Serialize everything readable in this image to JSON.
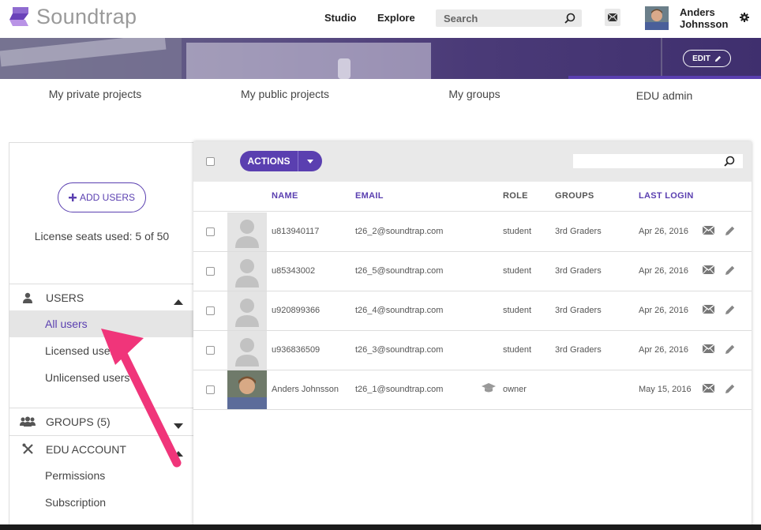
{
  "header": {
    "logo_text": "Soundtrap",
    "nav": [
      "Studio",
      "Explore"
    ],
    "search_placeholder": "Search",
    "user_first": "Anders",
    "user_last": "Johnsson"
  },
  "banner": {
    "edit_label": "EDIT"
  },
  "tabs": [
    {
      "label": "My private projects"
    },
    {
      "label": "My public projects"
    },
    {
      "label": "My groups"
    },
    {
      "label": "EDU admin",
      "active": true
    }
  ],
  "sidebar": {
    "add_users_label": "ADD USERS",
    "seats_label": "License seats used: 5 of 50",
    "users_section": "USERS",
    "users_items": [
      "All users",
      "Licensed users",
      "Unlicensed users"
    ],
    "groups_section": "GROUPS (5)",
    "edu_section": "EDU ACCOUNT",
    "edu_items": [
      "Permissions",
      "Subscription"
    ]
  },
  "table": {
    "actions_label": "ACTIONS",
    "columns": {
      "name": "NAME",
      "email": "EMAIL",
      "role": "ROLE",
      "groups": "GROUPS",
      "last_login": "LAST LOGIN"
    },
    "rows": [
      {
        "name": "u813940117",
        "email": "t26_2@soundtrap.com",
        "role": "student",
        "groups": "3rd Graders",
        "last_login": "Apr 26, 2016"
      },
      {
        "name": "u85343002",
        "email": "t26_5@soundtrap.com",
        "role": "student",
        "groups": "3rd Graders",
        "last_login": "Apr 26, 2016"
      },
      {
        "name": "u920899366",
        "email": "t26_4@soundtrap.com",
        "role": "student",
        "groups": "3rd Graders",
        "last_login": "Apr 26, 2016"
      },
      {
        "name": "u936836509",
        "email": "t26_3@soundtrap.com",
        "role": "student",
        "groups": "3rd Graders",
        "last_login": "Apr 26, 2016"
      },
      {
        "name": "Anders Johnsson",
        "email": "t26_1@soundtrap.com",
        "role": "owner",
        "groups": "",
        "last_login": "May 15, 2016"
      }
    ]
  },
  "colors": {
    "accent": "#5a3fb0",
    "annotation_arrow": "#f0357a"
  }
}
